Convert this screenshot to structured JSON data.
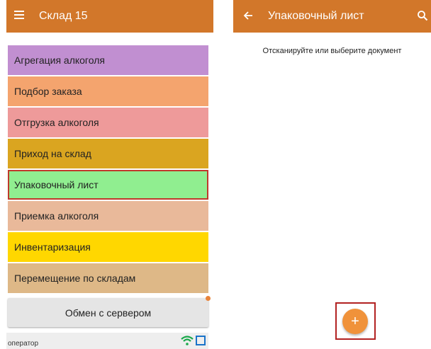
{
  "left_screen": {
    "title": "Склад 15",
    "menu_items": [
      {
        "label": "Агрегация алкоголя",
        "color": "#c18fd1"
      },
      {
        "label": "Подбор заказа",
        "color": "#f4a46e"
      },
      {
        "label": "Отгрузка алкоголя",
        "color": "#ee9a9a"
      },
      {
        "label": "Приход на склад",
        "color": "#daa520"
      },
      {
        "label": "Упаковочный лист",
        "color": "#90ee90",
        "selected": true
      },
      {
        "label": "Приемка алкоголя",
        "color": "#e9b99a"
      },
      {
        "label": "Инвентаризация",
        "color": "#ffd700"
      },
      {
        "label": "Перемещение по складам",
        "color": "#deb887"
      }
    ],
    "sync_button": "Обмен с сервером",
    "status_text": "оператор"
  },
  "right_screen": {
    "title": "Упаковочный лист",
    "hint": "Отсканируйте или выберите документ",
    "fab_label": "+"
  },
  "colors": {
    "appbar": "#d2772a",
    "fab": "#f0923a",
    "highlight": "#c0392b"
  }
}
